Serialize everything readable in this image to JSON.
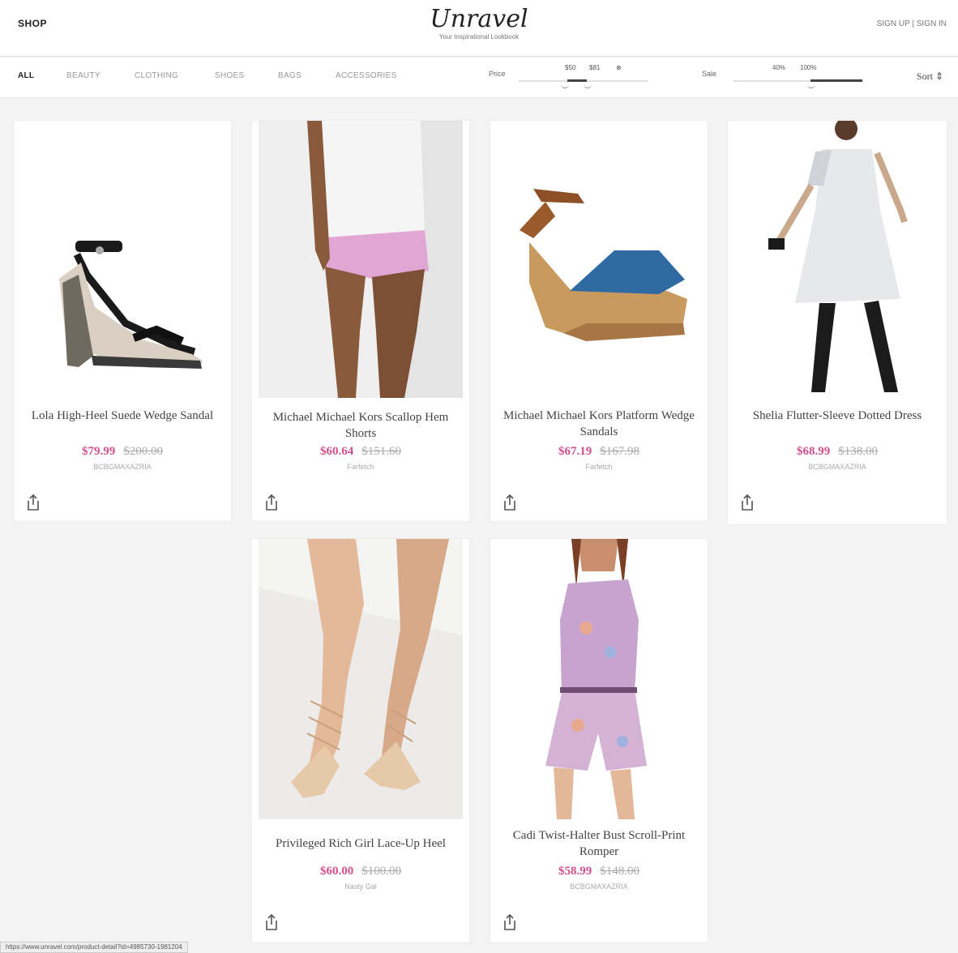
{
  "header": {
    "shop": "SHOP",
    "logo": "Unravel",
    "tagline": "Your Inspirational Lookbook",
    "auth": "SIGN UP  |  SIGN IN"
  },
  "categories": [
    "ALL",
    "BEAUTY",
    "CLOTHING",
    "SHOES",
    "BAGS",
    "ACCESSORIES"
  ],
  "price_filter": {
    "label": "Price",
    "min": "$50",
    "max": "$81"
  },
  "sale_filter": {
    "label": "Sale",
    "min": "40%",
    "max": "100%"
  },
  "sort": {
    "label": "Sort",
    "icon": "sort-icon"
  },
  "products": [
    {
      "title": "Lola High-Heel Suede Wedge Sandal",
      "price": "$79.99",
      "old_price": "$200.00",
      "retailer": "BCBGMAXAZRIA",
      "image": "black-wedge-sandal"
    },
    {
      "title": "Michael Michael Kors Scallop Hem Shorts",
      "price": "$60.64",
      "old_price": "$151.60",
      "retailer": "Farfetch",
      "image": "pink-scallop-shorts"
    },
    {
      "title": "Michael Michael Kors Platform Wedge Sandals",
      "price": "$67.19",
      "old_price": "$167.98",
      "retailer": "Farfetch",
      "image": "platform-wedge-sandal"
    },
    {
      "title": "Shelia Flutter-Sleeve Dotted Dress",
      "price": "$68.99",
      "old_price": "$138.00",
      "retailer": "BCBGMAXAZRIA",
      "image": "dotted-dress"
    },
    {
      "title": "Privileged Rich Girl Lace-Up Heel",
      "price": "$60.00",
      "old_price": "$100.00",
      "retailer": "Nasty Gal",
      "image": "lace-up-heel"
    },
    {
      "title": "Cadi Twist-Halter Bust Scroll-Print Romper",
      "price": "$58.99",
      "old_price": "$148.00",
      "retailer": "BCBGMAXAZRIA",
      "image": "print-romper"
    }
  ],
  "status_bar": "https://www.unravel.com/product-detail?id=4985730-1981204"
}
